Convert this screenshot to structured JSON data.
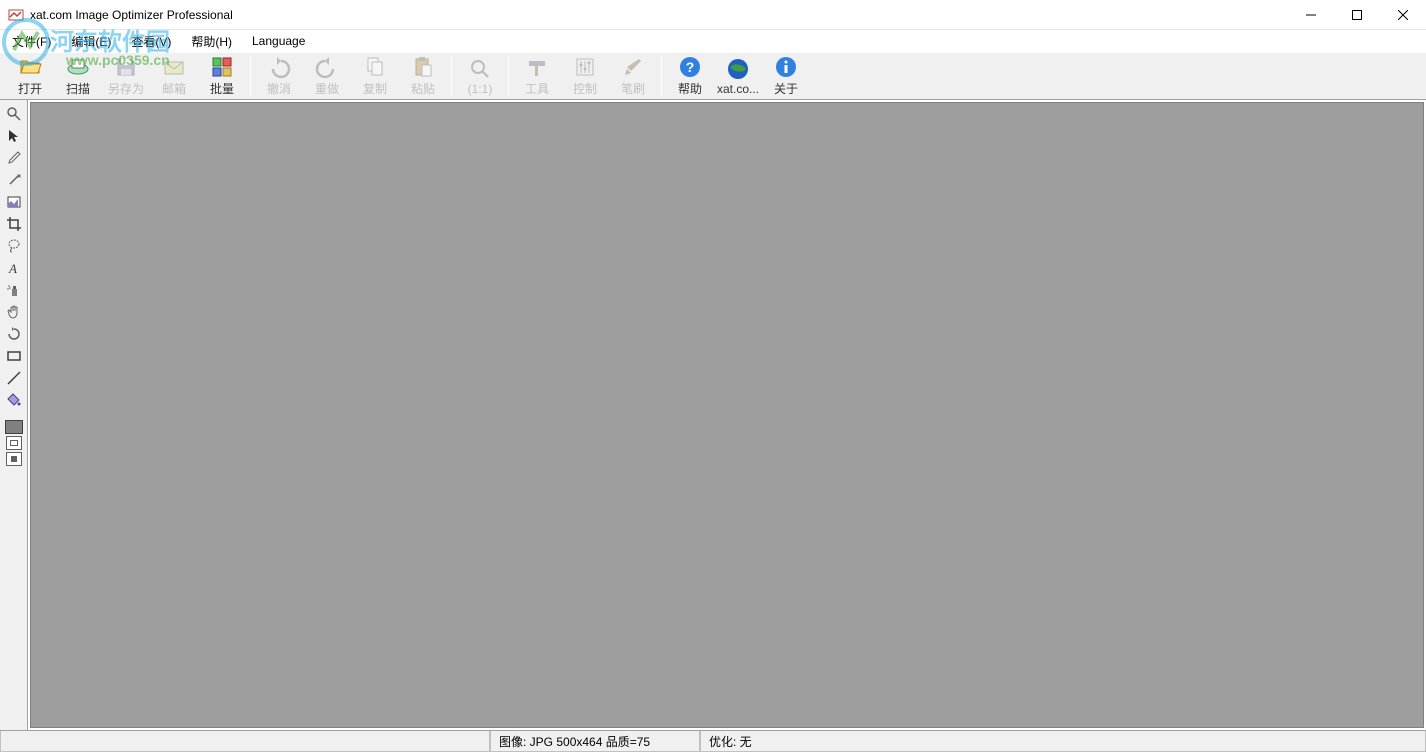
{
  "window": {
    "title": "xat.com   Image Optimizer Professional"
  },
  "menubar": {
    "file": "文件(F)",
    "edit": "编辑(E)",
    "view": "查看(V)",
    "help": "帮助(H)",
    "language": "Language"
  },
  "toolbar": {
    "open": "打开",
    "scan": "扫描",
    "saveas": "另存为",
    "mailbox": "邮箱",
    "batch": "批量",
    "undo": "撤消",
    "redo": "重做",
    "copy": "复制",
    "paste": "粘贴",
    "zoom11": "(1:1)",
    "tools": "工具",
    "control": "控制",
    "brush": "笔刷",
    "help": "帮助",
    "xatcom": "xat.co...",
    "about": "关于"
  },
  "statusbar": {
    "image_info": "图像: JPG 500x464  品质=75",
    "optimize_info": "优化: 无"
  },
  "watermark": {
    "text1": "河东软件园",
    "text2": "www.pc0359.cn"
  }
}
